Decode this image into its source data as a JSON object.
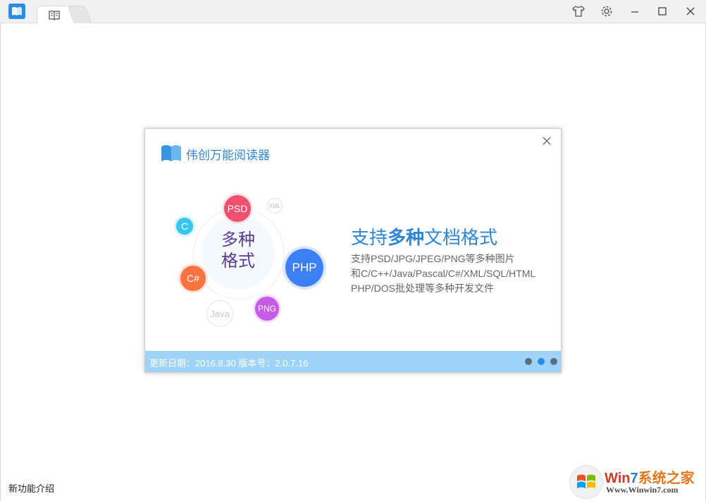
{
  "window": {
    "app_icon": "book-open-icon",
    "tabs": [
      {
        "icon": "book-icon"
      }
    ],
    "controls": [
      "skin-icon",
      "gear-icon",
      "minimize-icon",
      "maximize-icon",
      "close-icon"
    ]
  },
  "dialog": {
    "title": "伟创万能阅读器",
    "close_icon": "close-icon",
    "center_text_line1": "多种",
    "center_text_line2": "格式",
    "bubbles": {
      "psd": "PSD",
      "xml": "XML",
      "c": "C",
      "php": "PHP",
      "cs": "C#",
      "java": "Java",
      "png": "PNG"
    },
    "headline_pre": "支持",
    "headline_bold": "多种",
    "headline_post": "文档格式",
    "desc_line1": "支持PSD/JPG/JPEG/PNG等多种图片",
    "desc_line2": "和C/C++/Java/Pascal/C#/XML/SQL/HTML",
    "desc_line3": "PHP/DOS批处理等多种开发文件",
    "footer_text": "更新日期：2016.8.30  版本号：2.0.7.16",
    "pager": {
      "count": 3,
      "active_index": 1
    }
  },
  "bottom": {
    "new_features_link": "新功能介绍"
  },
  "watermark": {
    "title_brand_a": "Win",
    "title_brand_b": "7",
    "title_rest": "系统之家",
    "url": "Www.Winwin7.com"
  },
  "colors": {
    "accent": "#2f86d6",
    "footer_bg": "#9ed2f7",
    "psd": "#f0506e",
    "c": "#35c7f0",
    "php": "#3d7ff5",
    "cs": "#f8733d",
    "png": "#c55be8"
  }
}
